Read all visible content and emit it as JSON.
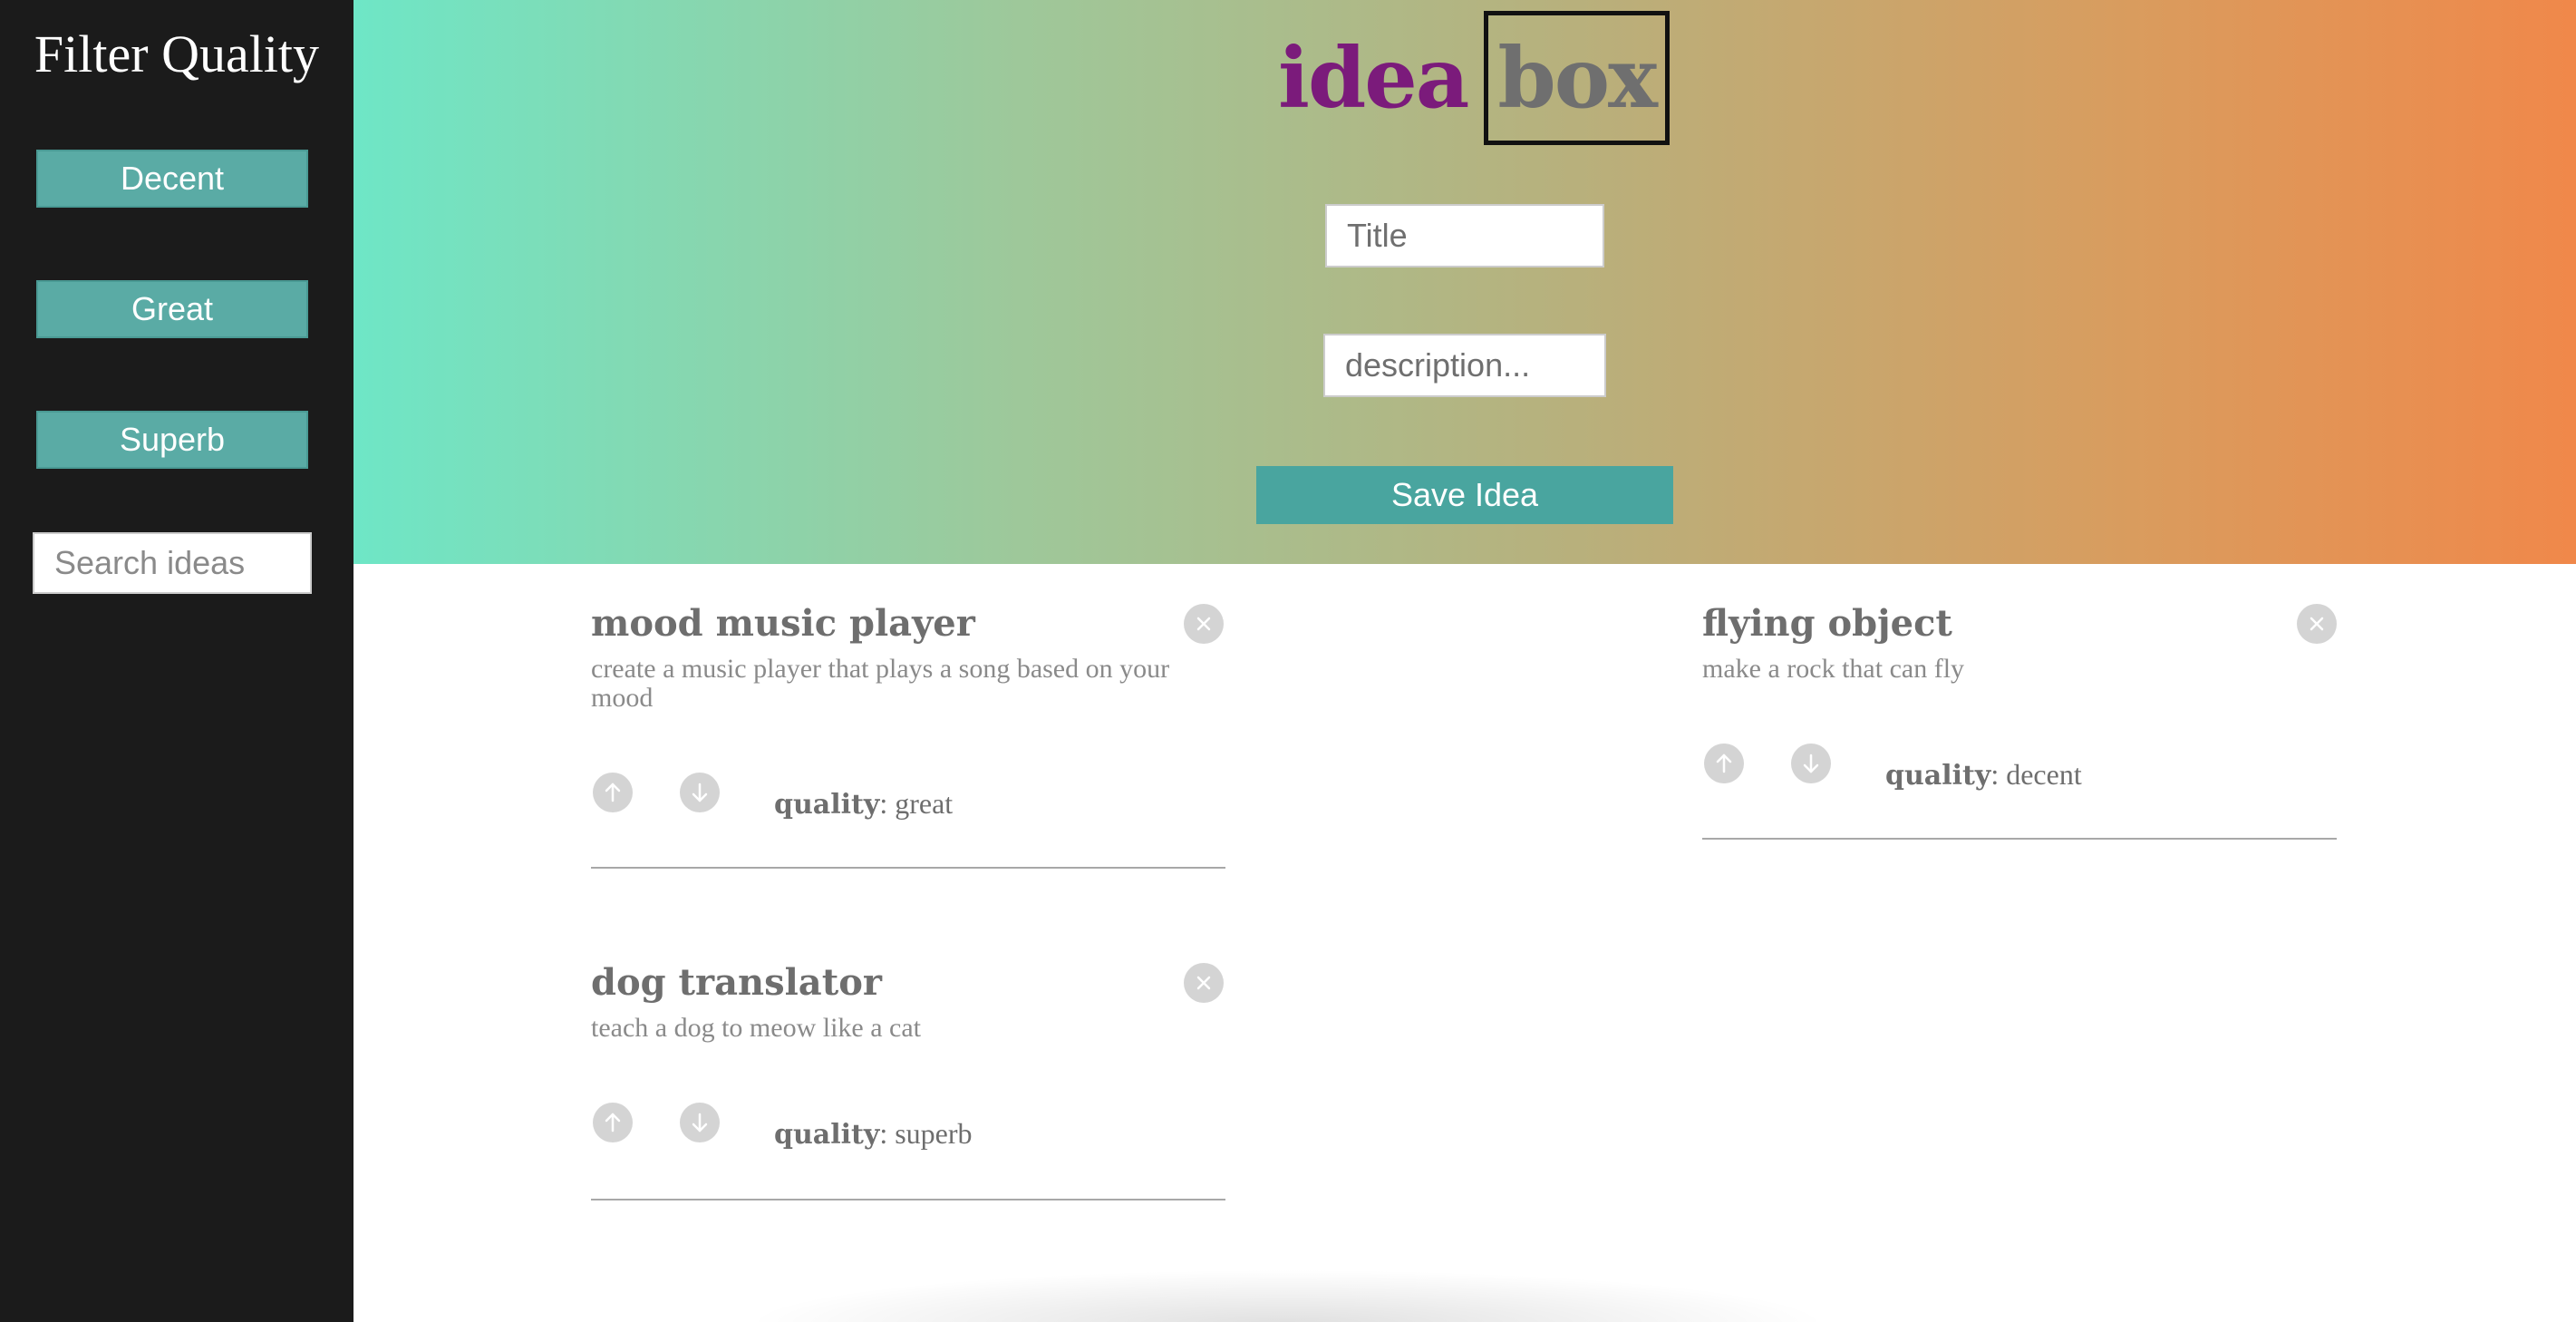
{
  "sidebar": {
    "title": "Filter Quality",
    "filters": [
      "Decent",
      "Great",
      "Superb"
    ],
    "search": {
      "placeholder": "Search ideas",
      "value": ""
    }
  },
  "header": {
    "logo_part1": "idea",
    "logo_part2": "box",
    "title_input": {
      "placeholder": "Title",
      "value": ""
    },
    "description_input": {
      "placeholder": "description...",
      "value": ""
    },
    "save_label": "Save Idea"
  },
  "quality_label": "quality",
  "ideas": [
    {
      "title": "mood music player",
      "description": "create a music player that plays a song based on your mood",
      "quality": "great"
    },
    {
      "title": "flying object",
      "description": "make a rock that can fly",
      "quality": "decent"
    },
    {
      "title": "dog translator",
      "description": "teach a dog to meow like a cat",
      "quality": "superb"
    }
  ],
  "icons": {
    "close": "close-icon",
    "upvote": "arrow-up-icon",
    "downvote": "arrow-down-icon"
  },
  "colors": {
    "sidebar_bg": "#1b1b1b",
    "button_teal": "#5aaba5",
    "save_teal": "#49a59f",
    "logo_purple": "#7b1b7b",
    "logo_gray": "#6f6f6f",
    "gradient_start": "#6ee6c6",
    "gradient_end": "#f0884a"
  }
}
